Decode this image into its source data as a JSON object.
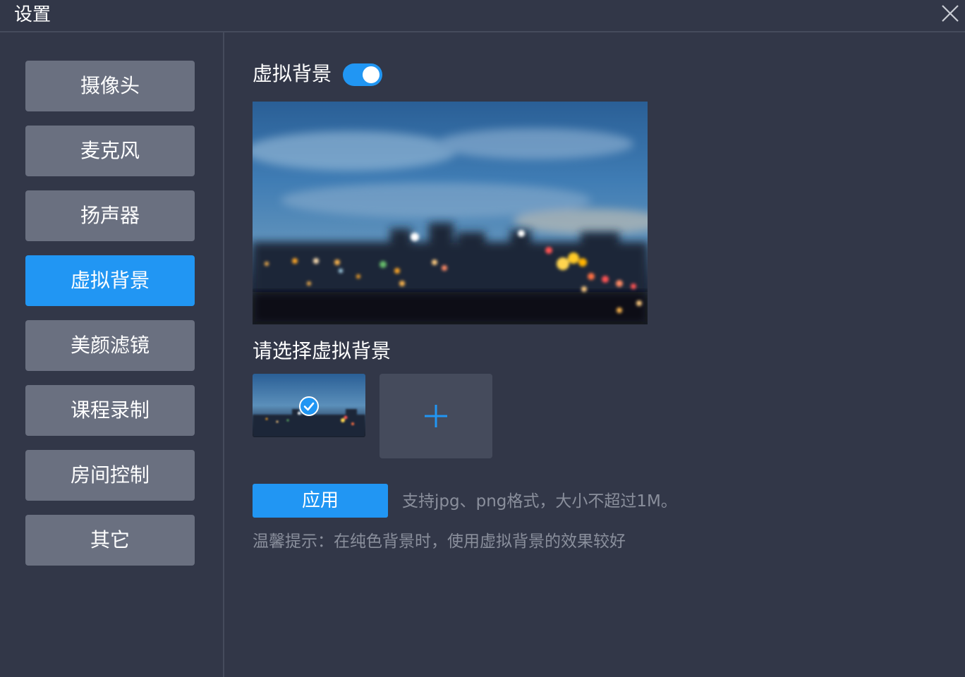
{
  "window": {
    "title": "设置",
    "close_icon": "close-icon"
  },
  "sidebar": {
    "items": [
      {
        "label": "摄像头",
        "active": false
      },
      {
        "label": "麦克风",
        "active": false
      },
      {
        "label": "扬声器",
        "active": false
      },
      {
        "label": "虚拟背景",
        "active": true
      },
      {
        "label": "美颜滤镜",
        "active": false
      },
      {
        "label": "课程录制",
        "active": false
      },
      {
        "label": "房间控制",
        "active": false
      },
      {
        "label": "其它",
        "active": false
      }
    ]
  },
  "virtual_background": {
    "label": "虚拟背景",
    "enabled": true,
    "select_label": "请选择虚拟背景",
    "selected_icon": "check-circle-icon",
    "add_icon": "plus-icon",
    "apply_label": "应用",
    "format_hint": "支持jpg、png格式，大小不超过1M。",
    "tip": "温馨提示：在纯色背景时，使用虚拟背景的效果较好"
  },
  "colors": {
    "background": "#323748",
    "divider": "#454b5c",
    "nav_item": "#6a7080",
    "accent": "#2196f3",
    "hint_text": "#8a8f9c"
  }
}
